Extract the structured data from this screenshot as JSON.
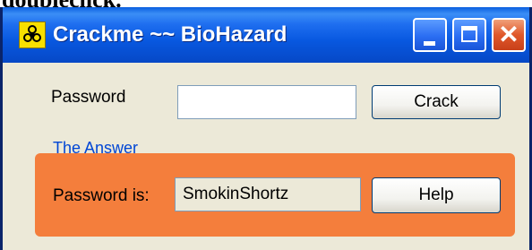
{
  "page_caption": "doubleclick.",
  "window": {
    "title": "Crackme ~~ BioHazard",
    "icon": "biohazard-icon"
  },
  "form": {
    "password_label": "Password",
    "password_value": "",
    "crack_label": "Crack"
  },
  "answer_group": {
    "label": "The Answer",
    "password_is_label": "Password is:",
    "password_is_value": "SmokinShortz",
    "help_label": "Help",
    "bg_color": "#f47e3c",
    "label_color": "#0046d5"
  },
  "titlebar_buttons": {
    "minimize": "minimize-icon",
    "maximize": "maximize-icon",
    "close": "close-icon"
  }
}
